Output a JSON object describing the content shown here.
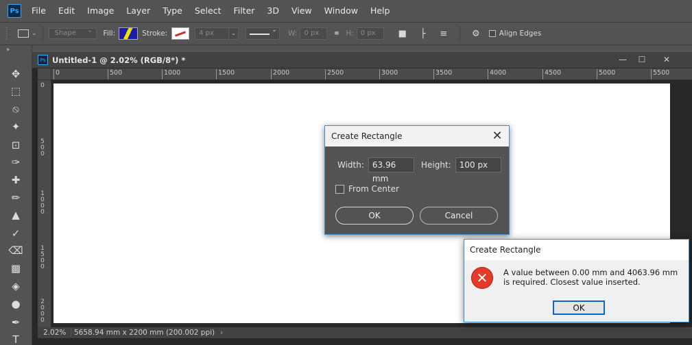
{
  "app": {
    "logo": "Ps",
    "menu": [
      "File",
      "Edit",
      "Image",
      "Layer",
      "Type",
      "Select",
      "Filter",
      "3D",
      "View",
      "Window",
      "Help"
    ]
  },
  "options": {
    "mode": "Shape",
    "fill_label": "Fill:",
    "stroke_label": "Stroke:",
    "stroke_width": "4 px",
    "w_label": "W:",
    "w_value": "0 px",
    "h_label": "H:",
    "h_value": "0 px",
    "align_edges": "Align Edges"
  },
  "document": {
    "title": "Untitled-1 @ 2.02% (RGB/8*) *",
    "ruler_top": [
      "0",
      "500",
      "1000",
      "1500",
      "2000",
      "2500",
      "3000",
      "3500",
      "4000",
      "4500",
      "5000",
      "5500"
    ],
    "ruler_left": [
      "0",
      "500",
      "1000",
      "1500",
      "2000"
    ],
    "status_zoom": "2.02%",
    "status_info": "5658.94 mm x 2200 mm (200.002 ppi)"
  },
  "dialog": {
    "title": "Create Rectangle",
    "width_label": "Width:",
    "width_value": "63.96 mm",
    "height_label": "Height:",
    "height_value": "100 px",
    "from_center_label": "From Center",
    "from_center_checked": false,
    "ok_label": "OK",
    "cancel_label": "Cancel"
  },
  "error": {
    "title": "Create Rectangle",
    "message": "A value between 0.00 mm and 4063.96 mm is required.  Closest value inserted.",
    "ok_label": "OK"
  },
  "colors": {
    "accent": "#3a8fd0",
    "error_icon": "#e33a29",
    "ui_gray": "#535353"
  }
}
